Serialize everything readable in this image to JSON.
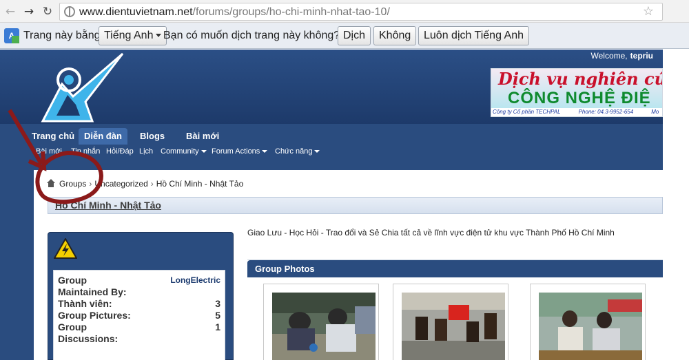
{
  "browser": {
    "url_host": "www.dientuvietnam.net",
    "url_path": "/forums/groups/ho-chi-minh-nhat-tao-10/"
  },
  "translate_bar": {
    "prefix": "Trang này bằng",
    "language": "Tiếng Anh",
    "question": "Bạn có muốn dịch trang này không?",
    "translate_btn": "Dịch",
    "no_btn": "Không",
    "always_btn": "Luôn dịch Tiếng Anh"
  },
  "header": {
    "welcome": "Welcome,",
    "username": "tepriu",
    "banner_line1": "Dịch vụ nghiên cứ",
    "banner_line2": "CÔNG NGHỆ ĐIỆ",
    "banner_company": "Công ty Cổ phần TECHPAL",
    "banner_phone": "Phone: 04.3-9952-654",
    "banner_extra": "Mo"
  },
  "nav": {
    "tabs": [
      "Trang chủ",
      "Diễn đàn",
      "Blogs",
      "Bài mới"
    ],
    "subnav": [
      "Bài mới",
      "Tin nhắn",
      "Hỏi/Đáp",
      "Lịch",
      "Community",
      "Forum Actions",
      "Chức năng"
    ]
  },
  "breadcrumb": {
    "items": [
      "Groups",
      "Uncategorized",
      "Hồ Chí Minh - Nhật Tảo"
    ]
  },
  "page": {
    "title": "Hồ Chí Minh - Nhật Tảo",
    "description": "Giao Lưu - Học Hỏi - Trao đổi và Sẻ Chia tất cả về lĩnh vực điện tử khu vực Thành Phố Hồ Chí Minh"
  },
  "group_info": {
    "group_label": "Group",
    "maintained_label": "Maintained By:",
    "maintained_by": "LongElectric",
    "members_label": "Thành viên:",
    "members": "3",
    "pictures_label": "Group Pictures:",
    "pictures": "5",
    "discussions_label1": "Group",
    "discussions_label2": "Discussions:",
    "discussions": "1"
  },
  "photos": {
    "title": "Group Photos"
  },
  "colors": {
    "brand_blue": "#2a4c7f",
    "annotation_red": "#8b1a1a"
  }
}
